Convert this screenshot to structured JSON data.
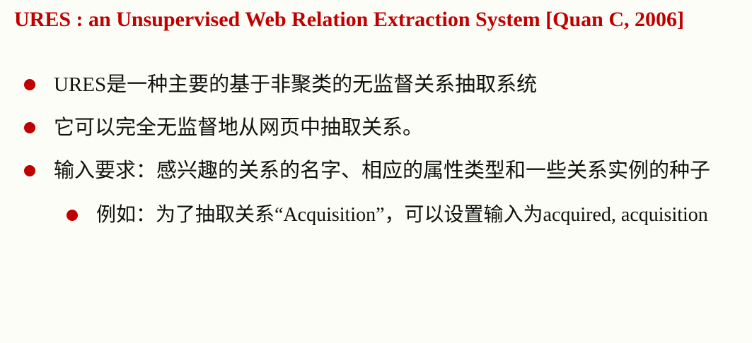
{
  "slide": {
    "title": "URES : an Unsupervised Web Relation Extraction System [Quan C, 2006]",
    "bullets": [
      {
        "text": "URES是一种主要的基于非聚类的无监督关系抽取系统"
      },
      {
        "text": "它可以完全无监督地从网页中抽取关系。"
      },
      {
        "text": "输入要求：感兴趣的关系的名字、相应的属性类型和一些关系实例的种子"
      }
    ],
    "sub_bullets": [
      {
        "text": "例如：为了抽取关系“Acquisition”，可以设置输入为acquired, acquisition"
      }
    ],
    "colors": {
      "title": "#c00000",
      "bullet": "#c00000",
      "text": "#111111",
      "background": "#fdfdf7"
    }
  }
}
